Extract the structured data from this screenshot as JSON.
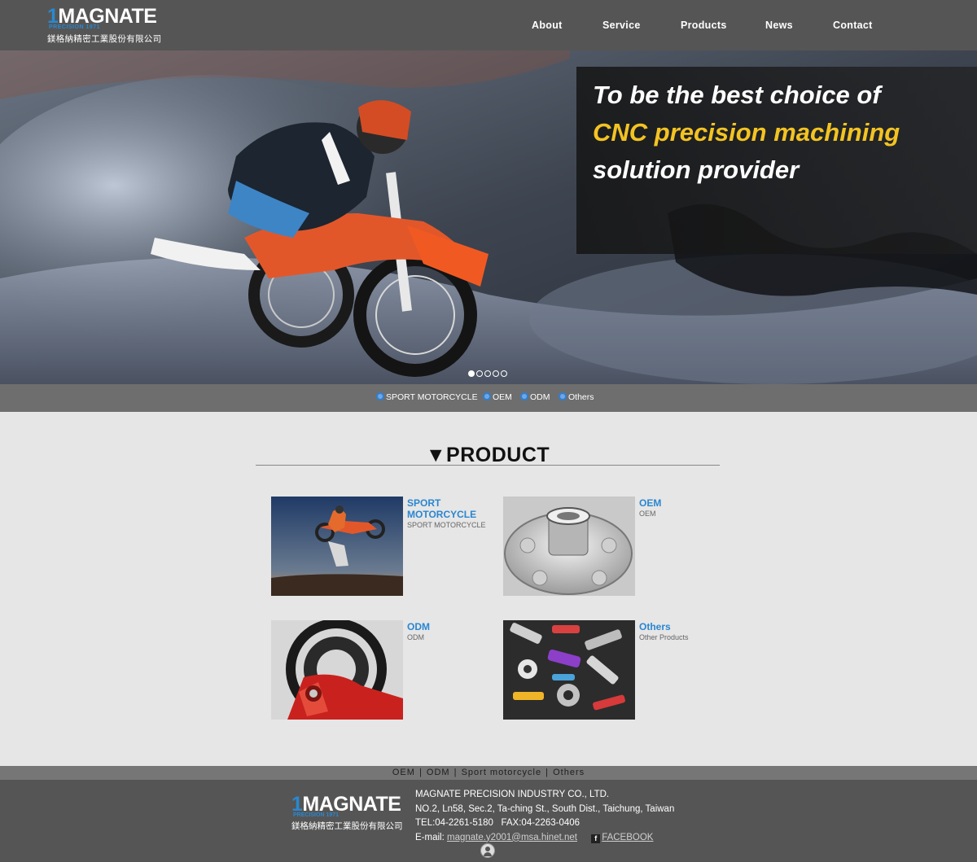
{
  "header": {
    "logo": {
      "word": "MAGNATE",
      "sub": "PRECISION 1971",
      "cn": "鎂格納精密工業股份有限公司"
    },
    "nav": [
      "About",
      "Service",
      "Products",
      "News",
      "Contact"
    ]
  },
  "hero": {
    "line1": "To be the best choice of",
    "line2": "CNC precision machining",
    "line3": "solution provider",
    "slides": 5,
    "active_slide": 1,
    "accent_color": "#f3c322"
  },
  "categories": [
    "SPORT MOTORCYCLE",
    "OEM",
    "ODM",
    "Others"
  ],
  "product": {
    "title": "▼PRODUCT",
    "items": [
      {
        "title": "SPORT MOTORCYCLE",
        "desc": "SPORT MOTORCYCLE",
        "image": "motocross-jump-photo"
      },
      {
        "title": "OEM",
        "desc": "OEM",
        "image": "cnc-hub-part-photo"
      },
      {
        "title": "ODM",
        "desc": "ODM",
        "image": "red-sprocket-photo"
      },
      {
        "title": "Others",
        "desc": "Other Products",
        "image": "assorted-parts-photo"
      }
    ]
  },
  "footer": {
    "links": [
      "OEM",
      "ODM",
      "Sport motorcycle",
      "Others"
    ],
    "company": "MAGNATE PRECISION INDUSTRY CO., LTD.",
    "address": "NO.2, Ln58, Sec.2, Ta-ching St., South Dist., Taichung, Taiwan",
    "tel": "TEL:04-2261-5180",
    "fax": "FAX:04-2263-0406",
    "email_label": "E-mail:",
    "email": "magnate.y2001@msa.hinet.net",
    "facebook": "FACEBOOK"
  },
  "colors": {
    "header_bg": "#555555",
    "link_blue": "#2a86d1",
    "page_bg": "#e6e6e6"
  }
}
